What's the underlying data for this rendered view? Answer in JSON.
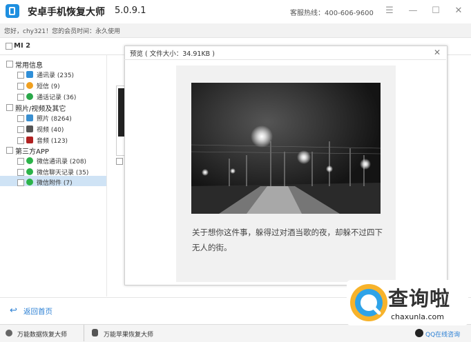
{
  "app": {
    "title": "安卓手机恢复大师",
    "version": "5.0.9.1",
    "hotline": "客服热线：400-606-9600",
    "greeting": "您好，chy321！您的会员时间：永久使用"
  },
  "window_controls": {
    "menu": "☰",
    "minimize": "—",
    "maximize": "☐",
    "close": "✕"
  },
  "device": {
    "label": "MI 2"
  },
  "tree": {
    "groups": [
      {
        "label": "常用信息",
        "items": [
          {
            "label": "通讯录 (235)",
            "icon": "contacts-icon",
            "color": "#2f8fd8"
          },
          {
            "label": "短信 (9)",
            "icon": "sms-icon",
            "color": "#f0a020"
          },
          {
            "label": "通话记录 (36)",
            "icon": "phone-icon",
            "color": "#2aa84a"
          }
        ]
      },
      {
        "label": "照片/视频及其它",
        "items": [
          {
            "label": "照片 (8264)",
            "icon": "photo-icon",
            "color": "#3a8fd0"
          },
          {
            "label": "视频 (40)",
            "icon": "video-icon",
            "color": "#555555"
          },
          {
            "label": "音频 (123)",
            "icon": "audio-icon",
            "color": "#b02020"
          }
        ]
      },
      {
        "label": "第三方APP",
        "items": [
          {
            "label": "微信通讯录 (208)",
            "icon": "wechat-icon",
            "color": "#2cb34a"
          },
          {
            "label": "微信聊天记录 (35)",
            "icon": "wechat-icon",
            "color": "#2cb34a"
          },
          {
            "label": "微信附件 (7)",
            "icon": "wechat-icon",
            "color": "#2cb34a"
          }
        ]
      }
    ]
  },
  "preview": {
    "title": "预览 ( 文件大小：34.91KB )",
    "close": "✕",
    "caption": "关于想你这件事，躲得过对酒当歌的夜，却躲不过四下无人的街。"
  },
  "footer": {
    "back_label": "返回首页",
    "back_icon": "↩",
    "left_link": "万能数据恢复大师",
    "middle_link": "万能苹果恢复大师",
    "qq_link": "QQ在线咨询"
  },
  "watermark": {
    "text": "查询啦",
    "url": "chaxunla.com"
  },
  "colors": {
    "accent": "#2a7fd4",
    "selected_row": "#cfe3f5"
  }
}
